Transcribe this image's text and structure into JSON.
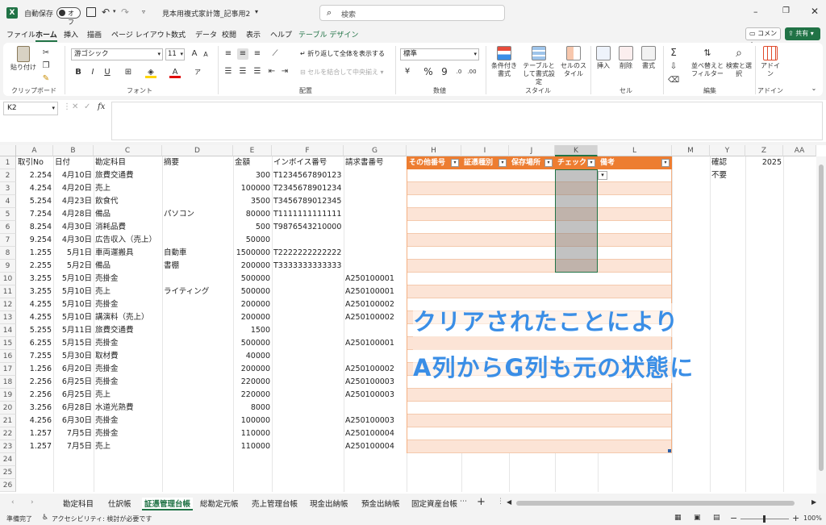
{
  "titlebar": {
    "autosave_label": "自動保存",
    "autosave_state": "オフ",
    "file_name": "見本用複式家計簿_記事用2",
    "search_placeholder": "検索"
  },
  "menu": {
    "items": [
      "ファイル",
      "ホーム",
      "挿入",
      "描画",
      "ページ レイアウト",
      "数式",
      "データ",
      "校閲",
      "表示",
      "ヘルプ",
      "テーブル デザイン"
    ],
    "active": "ホーム",
    "comment": "コメント",
    "share": "共有"
  },
  "ribbon": {
    "clipboard": {
      "paste": "貼り付け",
      "label": "クリップボード"
    },
    "font": {
      "name": "游ゴシック",
      "size": "11",
      "label": "フォント",
      "bold": "B",
      "italic": "I",
      "underline": "U"
    },
    "alignment": {
      "wrap": "折り返して全体を表示する",
      "merge": "セルを結合して中央揃え",
      "label": "配置"
    },
    "number": {
      "format": "標準",
      "label": "数値"
    },
    "styles": {
      "cond": "条件付き書式",
      "table": "テーブルとして書式設定",
      "cell": "セルのスタイル",
      "label": "スタイル"
    },
    "cells": {
      "insert": "挿入",
      "delete": "削除",
      "format": "書式",
      "label": "セル"
    },
    "editing": {
      "sort": "並べ替えとフィルター",
      "find": "検索と選択",
      "label": "編集"
    },
    "addins": {
      "addin": "アドイン",
      "label": "アドイン"
    }
  },
  "formula": {
    "namebox": "K2",
    "fx": "fx"
  },
  "columns": [
    "A",
    "B",
    "C",
    "D",
    "E",
    "F",
    "G",
    "H",
    "I",
    "J",
    "K",
    "L",
    "M",
    "Y",
    "Z",
    "AA"
  ],
  "rows": [
    {
      "a": "取引No",
      "b": "日付",
      "c": "勘定科目",
      "d": "摘要",
      "e": "金額",
      "f": "インボイス番号",
      "g": "請求書番号"
    },
    {
      "a": "2.254",
      "b": "4月10日",
      "c": "旅費交通費",
      "d": "",
      "e": "300",
      "f": "T1234567890123",
      "g": ""
    },
    {
      "a": "4.254",
      "b": "4月20日",
      "c": "売上",
      "d": "",
      "e": "100000",
      "f": "T2345678901234",
      "g": ""
    },
    {
      "a": "5.254",
      "b": "4月23日",
      "c": "飲食代",
      "d": "",
      "e": "3500",
      "f": "T3456789012345",
      "g": ""
    },
    {
      "a": "7.254",
      "b": "4月28日",
      "c": "備品",
      "d": "パソコン",
      "e": "80000",
      "f": "T1111111111111",
      "g": ""
    },
    {
      "a": "8.254",
      "b": "4月30日",
      "c": "消耗品費",
      "d": "",
      "e": "500",
      "f": "T9876543210000",
      "g": ""
    },
    {
      "a": "9.254",
      "b": "4月30日",
      "c": "広告収入（売上）",
      "d": "",
      "e": "50000",
      "f": "",
      "g": ""
    },
    {
      "a": "1.255",
      "b": "5月1日",
      "c": "車両運搬具",
      "d": "自動車",
      "e": "1500000",
      "f": "T2222222222222",
      "g": ""
    },
    {
      "a": "2.255",
      "b": "5月2日",
      "c": "備品",
      "d": "書棚",
      "e": "200000",
      "f": "T3333333333333",
      "g": ""
    },
    {
      "a": "3.255",
      "b": "5月10日",
      "c": "売掛金",
      "d": "",
      "e": "500000",
      "f": "",
      "g": "A250100001"
    },
    {
      "a": "3.255",
      "b": "5月10日",
      "c": "売上",
      "d": "ライティング",
      "e": "500000",
      "f": "",
      "g": "A250100001"
    },
    {
      "a": "4.255",
      "b": "5月10日",
      "c": "売掛金",
      "d": "",
      "e": "200000",
      "f": "",
      "g": "A250100002"
    },
    {
      "a": "4.255",
      "b": "5月10日",
      "c": "講演料（売上）",
      "d": "",
      "e": "200000",
      "f": "",
      "g": "A250100002"
    },
    {
      "a": "5.255",
      "b": "5月11日",
      "c": "旅費交通費",
      "d": "",
      "e": "1500",
      "f": "",
      "g": ""
    },
    {
      "a": "6.255",
      "b": "5月15日",
      "c": "売掛金",
      "d": "",
      "e": "500000",
      "f": "",
      "g": "A250100001"
    },
    {
      "a": "7.255",
      "b": "5月30日",
      "c": "取材費",
      "d": "",
      "e": "40000",
      "f": "",
      "g": ""
    },
    {
      "a": "1.256",
      "b": "6月20日",
      "c": "売掛金",
      "d": "",
      "e": "200000",
      "f": "",
      "g": "A250100002"
    },
    {
      "a": "2.256",
      "b": "6月25日",
      "c": "売掛金",
      "d": "",
      "e": "220000",
      "f": "",
      "g": "A250100003"
    },
    {
      "a": "2.256",
      "b": "6月25日",
      "c": "売上",
      "d": "",
      "e": "220000",
      "f": "",
      "g": "A250100003"
    },
    {
      "a": "3.256",
      "b": "6月28日",
      "c": "水道光熱費",
      "d": "",
      "e": "8000",
      "f": "",
      "g": ""
    },
    {
      "a": "4.256",
      "b": "6月30日",
      "c": "売掛金",
      "d": "",
      "e": "100000",
      "f": "",
      "g": "A250100003"
    },
    {
      "a": "1.257",
      "b": "7月5日",
      "c": "売掛金",
      "d": "",
      "e": "110000",
      "f": "",
      "g": "A250100004"
    },
    {
      "a": "1.257",
      "b": "7月5日",
      "c": "売上",
      "d": "",
      "e": "110000",
      "f": "",
      "g": "A250100004"
    },
    {
      "a": "",
      "b": "",
      "c": "",
      "d": "",
      "e": "",
      "f": "",
      "g": ""
    },
    {
      "a": "",
      "b": "",
      "c": "",
      "d": "",
      "e": "",
      "f": "",
      "g": ""
    },
    {
      "a": "",
      "b": "",
      "c": "",
      "d": "",
      "e": "",
      "f": "",
      "g": ""
    }
  ],
  "table_headers": [
    "その他番号",
    "証憑種別",
    "保存場所",
    "チェック",
    "備考"
  ],
  "side": {
    "y1": "確認",
    "y2": "不要",
    "z1": "2025"
  },
  "annotation": {
    "line1": "クリアされたことにより",
    "line2": "A列からG列も元の状態に"
  },
  "sheets": [
    "勘定科目",
    "仕訳帳",
    "証憑管理台帳",
    "総勘定元帳",
    "売上管理台帳",
    "現金出納帳",
    "預金出納帳",
    "固定資産台帳"
  ],
  "active_sheet": "証憑管理台帳",
  "status": {
    "ready": "準備完了",
    "accessibility": "アクセシビリティ: 検討が必要です",
    "zoom": "100%"
  },
  "colors": {
    "accent": "#ed7d31",
    "band": "#fce4d6",
    "green": "#217346",
    "annotation": "#3a8ee6"
  }
}
